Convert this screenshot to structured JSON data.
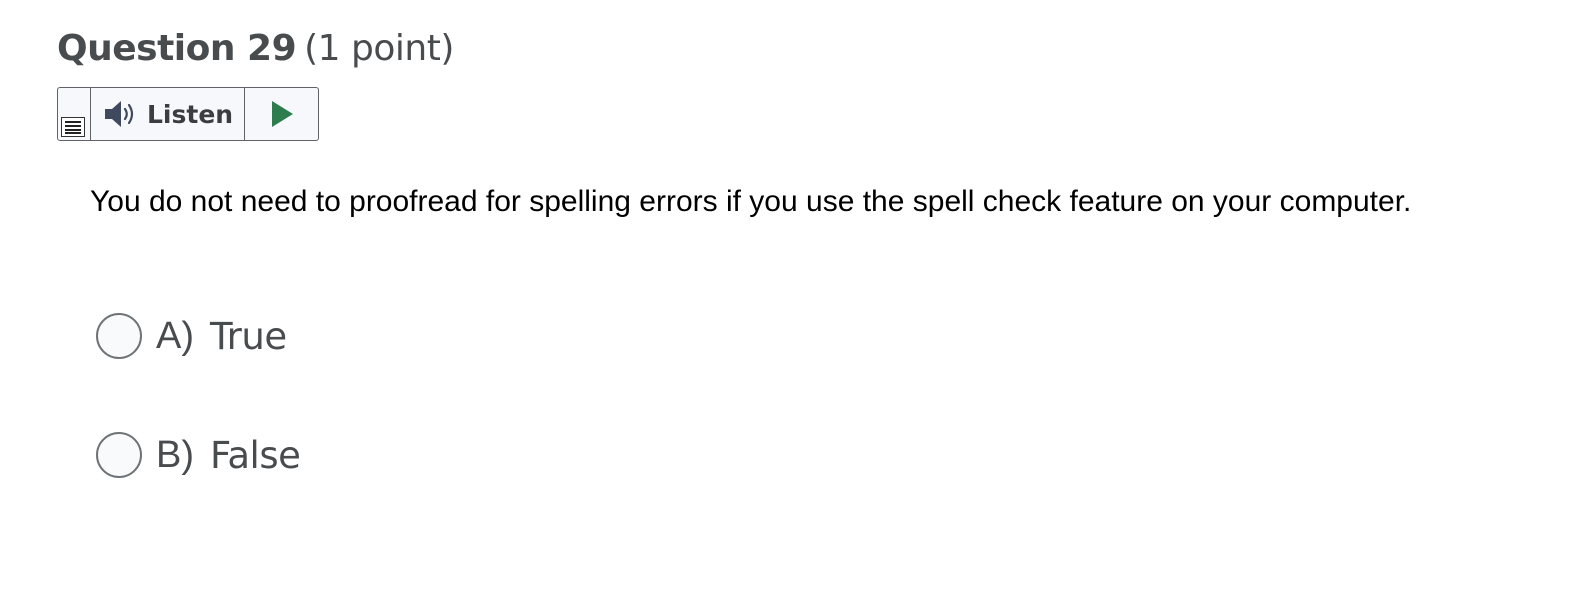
{
  "question": {
    "title": "Question 29",
    "points": "(1 point)",
    "text": "You do not need to proofread for spelling errors if you use the spell check feature on your computer."
  },
  "listen_widget": {
    "label": "Listen",
    "speaker_icon": "speaker-icon",
    "play_icon": "play-icon",
    "menu_icon": "menu-icon",
    "play_color": "#2e7d4f"
  },
  "answers": [
    {
      "letter": "A)",
      "text": "True",
      "selected": false
    },
    {
      "letter": "B)",
      "text": "False",
      "selected": false
    }
  ]
}
